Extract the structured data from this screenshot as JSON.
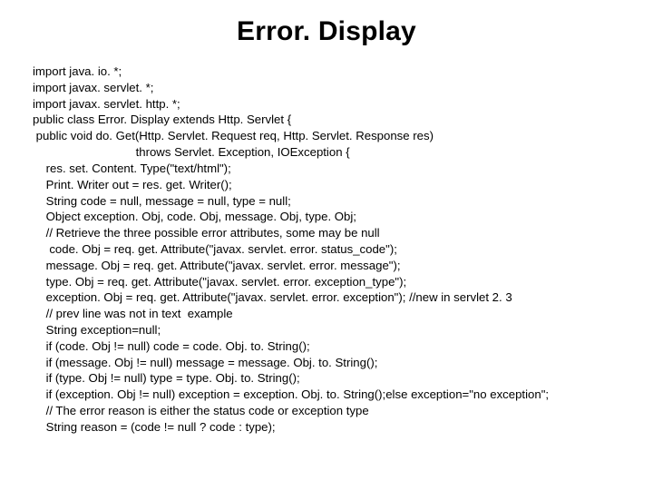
{
  "title": "Error. Display",
  "code_lines": [
    "import java. io. *;",
    "import javax. servlet. *;",
    "import javax. servlet. http. *;",
    "public class Error. Display extends Http. Servlet {",
    " public void do. Get(Http. Servlet. Request req, Http. Servlet. Response res)",
    "                               throws Servlet. Exception, IOException {",
    "    res. set. Content. Type(\"text/html\");",
    "    Print. Writer out = res. get. Writer();",
    "    String code = null, message = null, type = null;",
    "    Object exception. Obj, code. Obj, message. Obj, type. Obj;",
    "    // Retrieve the three possible error attributes, some may be null",
    "     code. Obj = req. get. Attribute(\"javax. servlet. error. status_code\");",
    "    message. Obj = req. get. Attribute(\"javax. servlet. error. message\");",
    "    type. Obj = req. get. Attribute(\"javax. servlet. error. exception_type\");",
    "    exception. Obj = req. get. Attribute(\"javax. servlet. error. exception\"); //new in servlet 2. 3",
    "    // prev line was not in text  example",
    "    String exception=null;",
    "    if (code. Obj != null) code = code. Obj. to. String();",
    "    if (message. Obj != null) message = message. Obj. to. String();",
    "    if (type. Obj != null) type = type. Obj. to. String();",
    "    if (exception. Obj != null) exception = exception. Obj. to. String();else exception=\"no exception\";",
    "    // The error reason is either the status code or exception type",
    "    String reason = (code != null ? code : type);"
  ]
}
